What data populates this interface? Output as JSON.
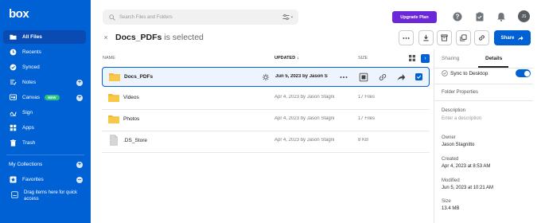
{
  "app": {
    "logo": "box"
  },
  "sidebar": {
    "items": [
      {
        "label": "All Files",
        "icon": "folder-icon"
      },
      {
        "label": "Recents",
        "icon": "clock-icon"
      },
      {
        "label": "Synced",
        "icon": "check-circle-icon"
      },
      {
        "label": "Notes",
        "icon": "notes-icon"
      },
      {
        "label": "Canvas",
        "icon": "canvas-icon",
        "badge": "NEW"
      },
      {
        "label": "Sign",
        "icon": "sign-icon"
      },
      {
        "label": "Apps",
        "icon": "apps-icon"
      },
      {
        "label": "Trash",
        "icon": "trash-icon"
      }
    ],
    "collections": "My Collections",
    "favorites": "Favorites",
    "drag_hint": "Drag items here for quick access"
  },
  "topbar": {
    "search_placeholder": "Search Files and Folders",
    "upgrade_label": "Upgrade Plan",
    "avatar_initials": "JS"
  },
  "header": {
    "close": "×",
    "selected_name": "Docs_PDFs",
    "selected_suffix": " is selected",
    "share_label": "Share"
  },
  "columns": {
    "name": "NAME",
    "updated": "UPDATED",
    "size": "SIZE"
  },
  "rows": [
    {
      "name": "Docs_PDFs",
      "updated": "Jun 5, 2023 by Jason S",
      "size": "",
      "type": "folder"
    },
    {
      "name": "Videos",
      "updated": "Apr 4, 2023 by Jason Stagni...",
      "size": "17 Files",
      "type": "folder"
    },
    {
      "name": "Photos",
      "updated": "Apr 4, 2023 by Jason Stagni...",
      "size": "17 Files",
      "type": "folder"
    },
    {
      "name": ".DS_Store",
      "updated": "Apr 4, 2023 by Jason Stagni...",
      "size": "8 KB",
      "type": "file"
    }
  ],
  "right_panel": {
    "tabs": [
      "Sharing",
      "Details"
    ],
    "sync_label": "Sync to Desktop",
    "folder_properties": "Folder Properties",
    "description_label": "Description",
    "description_placeholder": "Enter a description",
    "owner_label": "Owner",
    "owner_value": "Jason Stagnitto",
    "created_label": "Created",
    "created_value": "Apr 4, 2023 at 8:53 AM",
    "modified_label": "Modified",
    "modified_value": "Jun 5, 2023 at 10:21 AM",
    "size_label": "Size",
    "size_value": "13.4 MB"
  },
  "colors": {
    "brand": "#0061d5",
    "upgrade": "#6b27d8",
    "folder": "#f5b731"
  }
}
